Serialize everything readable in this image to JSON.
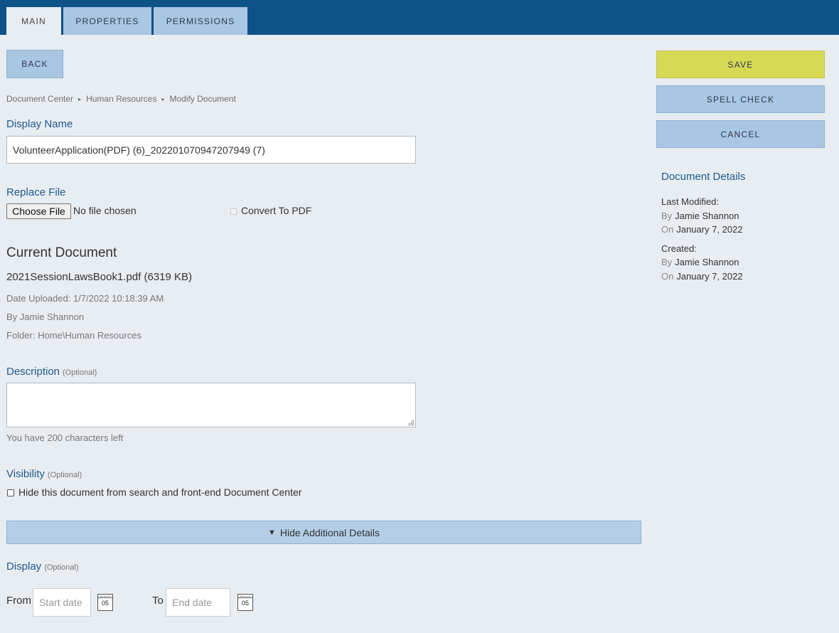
{
  "tabs": [
    {
      "label": "MAIN",
      "active": true
    },
    {
      "label": "PROPERTIES",
      "active": false
    },
    {
      "label": "PERMISSIONS",
      "active": false
    }
  ],
  "buttons": {
    "back": "BACK",
    "save": "SAVE",
    "spell_check": "SPELL CHECK",
    "cancel": "CANCEL"
  },
  "breadcrumb": [
    "Document Center",
    "Human Resources",
    "Modify Document"
  ],
  "display_name": {
    "label": "Display Name",
    "value": "VolunteerApplication(PDF) (6)_202201070947207949 (7)"
  },
  "replace_file": {
    "label": "Replace File",
    "button": "Choose File",
    "status": "No file chosen",
    "convert_label": "Convert To PDF"
  },
  "current_document": {
    "heading": "Current Document",
    "file": "2021SessionLawsBook1.pdf (6319 KB)",
    "uploaded": "Date Uploaded: 1/7/2022 10:18:39 AM",
    "by": "By Jamie Shannon",
    "folder": "Folder: Home\\Human Resources"
  },
  "description": {
    "label": "Description",
    "optional": "(Optional)",
    "value": "",
    "counter": "You have 200 characters left"
  },
  "visibility": {
    "label": "Visibility",
    "optional": "(Optional)",
    "checkbox_label": "Hide this document from search and front-end Document Center"
  },
  "additional_toggle": {
    "arrow": "▼",
    "label": "Hide Additional Details"
  },
  "display": {
    "label": "Display",
    "optional": "(Optional)",
    "from_label": "From",
    "from_placeholder": "Start date",
    "to_label": "To",
    "to_placeholder": "End date",
    "calendar_day": "05"
  },
  "document_details": {
    "title": "Document Details",
    "last_modified_label": "Last Modified:",
    "last_modified_by_pre": "By",
    "last_modified_by": "Jamie Shannon",
    "last_modified_on_pre": "On",
    "last_modified_on": "January 7, 2022",
    "created_label": "Created:",
    "created_by_pre": "By",
    "created_by": "Jamie Shannon",
    "created_on_pre": "On",
    "created_on": "January 7, 2022"
  },
  "colors": {
    "header": "#0e5388",
    "tab": "#a9c6e3",
    "save": "#d7d955",
    "accent_text": "#1e5a8c",
    "background": "#e8edf2"
  }
}
